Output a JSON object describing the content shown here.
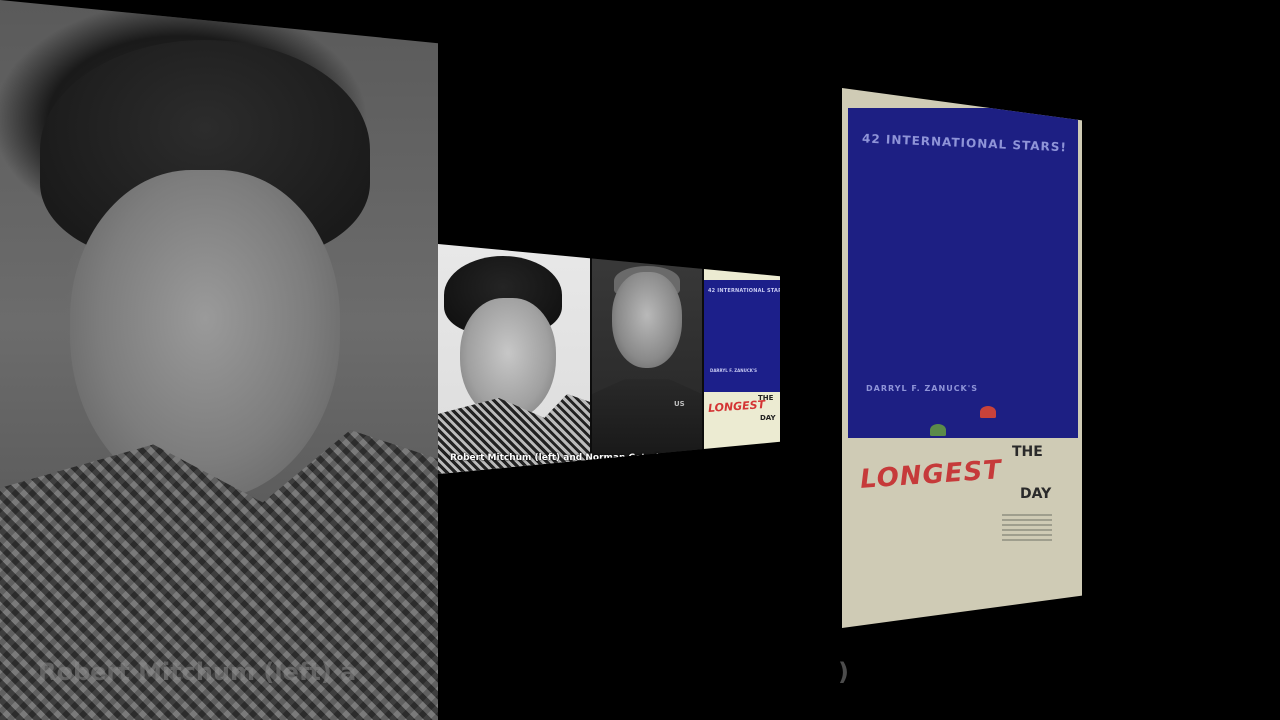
{
  "caption": "Robert Mitchum (left) and Norman Cota (center)",
  "caption_big_visible_left": "Robert Mitchum (left) a",
  "caption_big_visible_right": ")",
  "poster": {
    "tagline": "42 INTERNATIONAL STARS!",
    "presenter": "DARRYL F. ZANUCK'S",
    "title_the": "THE",
    "title_longest": "LONGEST",
    "title_day": "DAY"
  },
  "uniform_tag": "US",
  "colors": {
    "poster_blue": "#1c1f8a",
    "poster_title_red": "#d43434",
    "poster_paper": "#ecebd2",
    "background": "#000000"
  }
}
